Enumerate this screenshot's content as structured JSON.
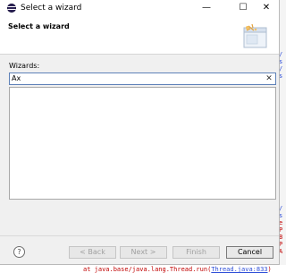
{
  "window": {
    "title": "Select a wizard",
    "minimize_glyph": "—",
    "maximize_glyph": "☐",
    "close_glyph": "✕"
  },
  "header": {
    "page_title": "Select a wizard",
    "banner_icon": "wizard-banner-icon"
  },
  "filter": {
    "label": "Wizards:",
    "value": "Ax",
    "clear_glyph": "✕"
  },
  "footer": {
    "help_glyph": "?",
    "back_label": "< Back",
    "next_label": "Next >",
    "finish_label": "Finish",
    "cancel_label": "Cancel"
  },
  "background": {
    "side_fragments": [
      "/",
      "s",
      "/",
      "s",
      "",
      "",
      "",
      "",
      "",
      "",
      "",
      "",
      "",
      "",
      "",
      "",
      "",
      "",
      "",
      "",
      "",
      "",
      "",
      "",
      "",
      "",
      "/",
      "s",
      "e",
      "P",
      "B",
      "P",
      "A"
    ],
    "trace_prefix": "at java.base/java.lang.Thread.run(",
    "trace_link": "Thread.java:833",
    "trace_suffix": ")"
  },
  "colors": {
    "accent": "#5e81b8",
    "error_text": "#c00000",
    "link_text": "#2a4bd7",
    "app_icon": "#2c2255"
  }
}
